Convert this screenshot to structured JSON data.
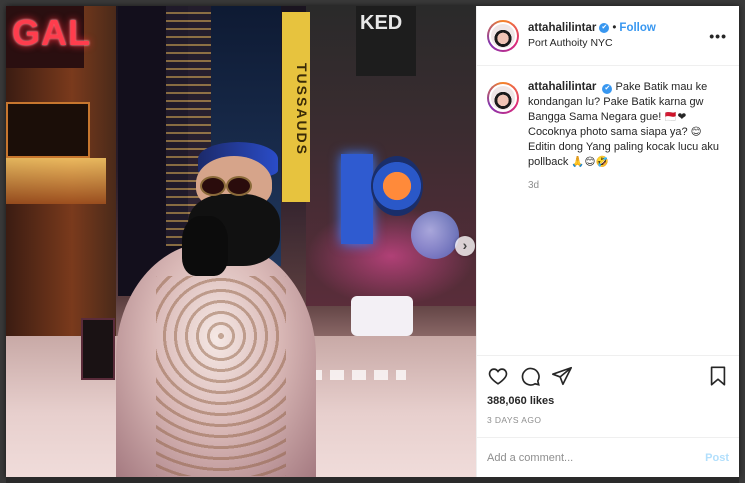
{
  "post": {
    "username": "attahalilintar",
    "verified_mark": "✔",
    "separator": "•",
    "follow_label": "Follow",
    "location": "Port Authoity NYC",
    "more_label": "•••",
    "photo_signs": {
      "gal": "GAL",
      "tussauds": "TUSSAUDS",
      "ked": "KED"
    },
    "caption": {
      "line1": "Pake Batik mau ke kondangan lu? Pake Batik karna gw Bangga Sama Negara gue!",
      "line1_emoji": "🇲🇨❤",
      "line2": "Cocoknya photo sama siapa ya?",
      "line2_emoji": "😊",
      "line3": "Editin dong Yang paling kocak lucu aku pollback",
      "line3_emoji": "🙏😊🤣",
      "time_ago": "3d"
    },
    "likes": "388,060 likes",
    "date": "3 DAYS AGO",
    "add_comment_placeholder": "Add a comment...",
    "post_label": "Post",
    "next_label": "›",
    "icons": {
      "like": "heart-icon",
      "comment": "comment-icon",
      "share": "share-icon",
      "save": "bookmark-icon",
      "next": "chevron-right-icon",
      "more": "more-icon"
    },
    "colors": {
      "link_blue": "#3897f0",
      "post_disabled": "#b2dffc",
      "muted": "#8e8e8e"
    }
  }
}
